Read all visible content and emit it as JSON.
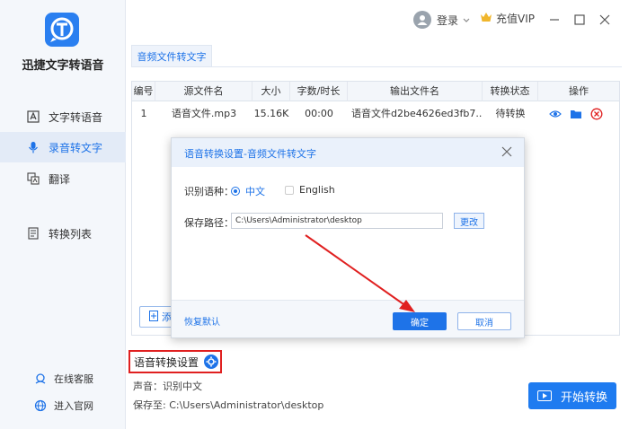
{
  "app": {
    "name": "迅捷文字转语音"
  },
  "sidebar": {
    "items": [
      {
        "label": "文字转语音",
        "icon": "text-to-speech-icon"
      },
      {
        "label": "录音转文字",
        "icon": "microphone-icon"
      },
      {
        "label": "翻译",
        "icon": "translate-icon"
      },
      {
        "label": "转换列表",
        "icon": "convert-list-icon"
      }
    ],
    "active_index": 1,
    "links": [
      {
        "label": "在线客服",
        "icon": "customer-service-icon"
      },
      {
        "label": "进入官网",
        "icon": "globe-icon"
      }
    ]
  },
  "topbar": {
    "login": "登录",
    "vip": "充值VIP"
  },
  "tab": {
    "label": "音频文件转文字"
  },
  "table": {
    "headers": [
      "编号",
      "源文件名",
      "大小",
      "字数/时长",
      "输出文件名",
      "转换状态",
      "操作"
    ],
    "rows": [
      {
        "no": "1",
        "source": "语音文件.mp3",
        "size": "15.16K",
        "duration": "00:00",
        "output": "语音文件d2be4626ed3fb7...",
        "status": "待转换"
      }
    ],
    "add_label": "添"
  },
  "settings": {
    "title": "语音转换设置",
    "voice_line": "声音：识别中文",
    "save_line": "保存至: C:\\Users\\Administrator\\desktop"
  },
  "start_button": "开始转换",
  "dialog": {
    "title": "语音转换设置-音频文件转文字",
    "lang_label": "识别语种：",
    "lang_options": [
      "中文",
      "English"
    ],
    "lang_selected": "中文",
    "path_label": "保存路径：",
    "path_value": "C:\\Users\\Administrator\\desktop",
    "change_button": "更改",
    "reset_link": "恢复默认",
    "ok_button": "确定",
    "cancel_button": "取消"
  },
  "colors": {
    "accent": "#1e73e8",
    "highlight": "#e02020"
  }
}
